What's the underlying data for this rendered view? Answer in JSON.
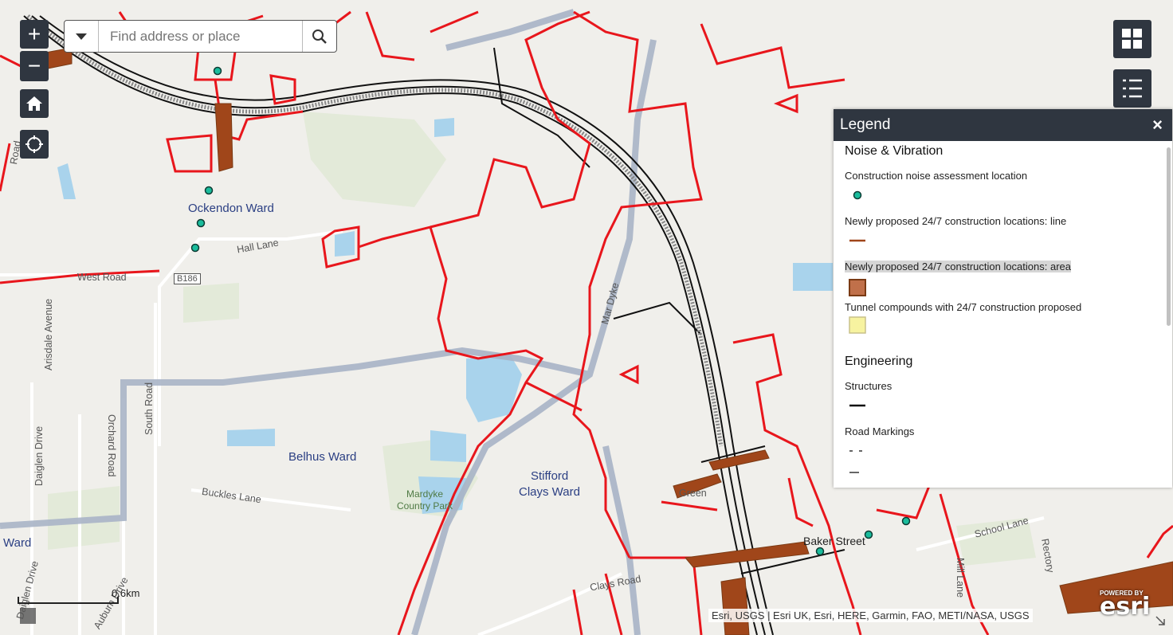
{
  "search": {
    "placeholder": "Find address or place"
  },
  "controls": {
    "zoom_in": "+",
    "zoom_out": "−"
  },
  "legend": {
    "title": "Legend",
    "close": "×",
    "groups": [
      {
        "title": "Noise & Vibration",
        "items": [
          "Construction noise assessment location",
          "Newly proposed 24/7 construction locations: line",
          "Newly proposed 24/7 construction locations: area",
          "Tunnel compounds with 24/7 construction proposed"
        ]
      },
      {
        "title": "Engineering",
        "items": [
          "Structures",
          "Road Markings"
        ]
      }
    ]
  },
  "map": {
    "wards": [
      "Ockendon Ward",
      "Belhus Ward",
      "Stifford",
      "Clays Ward",
      "Ward"
    ],
    "places": [
      "Mardyke",
      "Country Park",
      "Baker Street"
    ],
    "roads": [
      "Hall Lane",
      "West Road",
      "B186",
      "Arisdale Avenue",
      "South Road",
      "Orchard Road",
      "Daiglen Drive",
      "Buckles Lane",
      "School Lane",
      "Mill Lane",
      "Mar Dyke",
      "Rectory",
      "Road",
      "Daiglen Drive",
      "Green",
      "Clays Road",
      "Auburn Drive"
    ],
    "scale": "0.6km",
    "attribution": "Esri, USGS | Esri UK, Esri, HERE, Garmin, FAO, METI/NASA, USGS",
    "powered_by": "POWERED BY",
    "brand": "esri"
  },
  "colors": {
    "boundary": "#e8161c",
    "construction": "#a0461a",
    "noise_point": "#1abc9c",
    "tunnel": "#f7f3a0",
    "water": "#a9d3ec",
    "ward_line": "#a8b4c7",
    "control": "#2f3640"
  },
  "icons": [
    "zoom-in-icon",
    "zoom-out-icon",
    "home-icon",
    "locate-icon",
    "dropdown-icon",
    "search-icon",
    "basemap-gallery-icon",
    "legend-list-icon",
    "close-icon",
    "resize-icon"
  ]
}
